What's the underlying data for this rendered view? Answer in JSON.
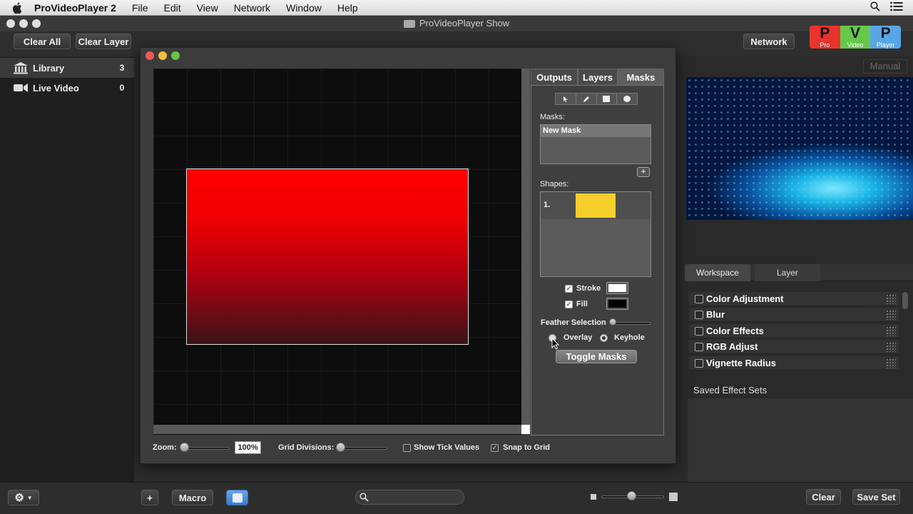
{
  "menubar": {
    "app_name": "ProVideoPlayer 2",
    "items": [
      "File",
      "Edit",
      "View",
      "Network",
      "Window",
      "Help"
    ]
  },
  "window": {
    "title": "ProVideoPlayer Show"
  },
  "toolbar": {
    "clear_all": "Clear All",
    "clear_layer": "Clear Layer",
    "network": "Network",
    "logo_letters": [
      "P",
      "V",
      "P"
    ],
    "logo_subs": [
      "Pro",
      "Video",
      "Player"
    ]
  },
  "sidebar": {
    "items": [
      {
        "label": "Library",
        "count": "3"
      },
      {
        "label": "Live Video",
        "count": "0"
      }
    ]
  },
  "editor": {
    "tabs": [
      "Outputs",
      "Layers",
      "Masks"
    ],
    "masks_label": "Masks:",
    "masks_list": [
      "New Mask"
    ],
    "shapes_label": "Shapes:",
    "shape_index": "1.",
    "shape_color": "#f6cf2c",
    "stroke_label": "Stroke",
    "fill_label": "Fill",
    "feather_label": "Feather Selection",
    "overlay_label": "Overlay",
    "keyhole_label": "Keyhole",
    "toggle_masks": "Toggle Masks",
    "zoom_label": "Zoom:",
    "zoom_value": "100%",
    "grid_divisions_label": "Grid Divisions:",
    "show_tick_values": "Show Tick Values",
    "snap_to_grid": "Snap to Grid",
    "mask_gradient_top": "#ff0000",
    "mask_gradient_bottom": "#3a1416"
  },
  "right": {
    "manual": "Manual",
    "tabs": [
      "Workspace",
      "Layer"
    ],
    "effects": [
      "Color Adjustment",
      "Blur",
      "Color Effects",
      "RGB Adjust",
      "Vignette Radius"
    ],
    "saved_effect_sets": "Saved Effect Sets"
  },
  "bottom": {
    "macro": "Macro",
    "clear": "Clear",
    "save_set": "Save Set"
  }
}
